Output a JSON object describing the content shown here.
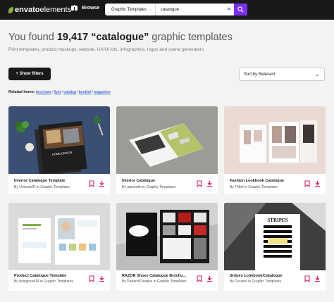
{
  "header": {
    "logo_bold": "envato",
    "logo_light": "elements",
    "browse_label": "Browse",
    "category_select": "Graphic Templates",
    "search_value": "catalogue",
    "clear_icon": "close-icon",
    "search_icon": "search-icon"
  },
  "results": {
    "prefix": "You found ",
    "count": "19,417",
    "query": " “catalogue”",
    "suffix": " graphic templates",
    "subheading": "Print templates, product mockups, website, UX/UI kits, infographics, logos and scene generators"
  },
  "filters": {
    "show_filters_label": "+ Show filters",
    "sort_label": "Sort by Relevant"
  },
  "related": {
    "label": "Related items:",
    "items": [
      "brochure",
      "flyer",
      "catalog",
      "booklet",
      "magazine"
    ]
  },
  "cards": [
    {
      "title": "Interior Catalogue Template",
      "author": "By UnicodeID in Graphic Templates"
    },
    {
      "title": "Interior Catalogue",
      "author": "By aqrstudio in Graphic Templates"
    },
    {
      "title": "Fashion Lookbook Catalogue",
      "author": "By TMint in Graphic Templates"
    },
    {
      "title": "Product Catalogue Template",
      "author": "By designesd14 in Graphic Templates"
    },
    {
      "title": "RAZOR Shoes Catalogue Brochu...",
      "author": "By RahardiCreative in Graphic Templates"
    },
    {
      "title": "Stripes Lookbook/Catalogue",
      "author": "By Gouwer in Graphic Templates"
    }
  ],
  "thumb_text": {
    "interior_cover": "HOME DESIGN",
    "stripes_cover": "STRIPES"
  },
  "colors": {
    "topbar": "#191919",
    "brand_green": "#82b440",
    "search_button": "#7a2ff5",
    "link": "#1a4fd1",
    "action_pink": "#e0245e"
  }
}
